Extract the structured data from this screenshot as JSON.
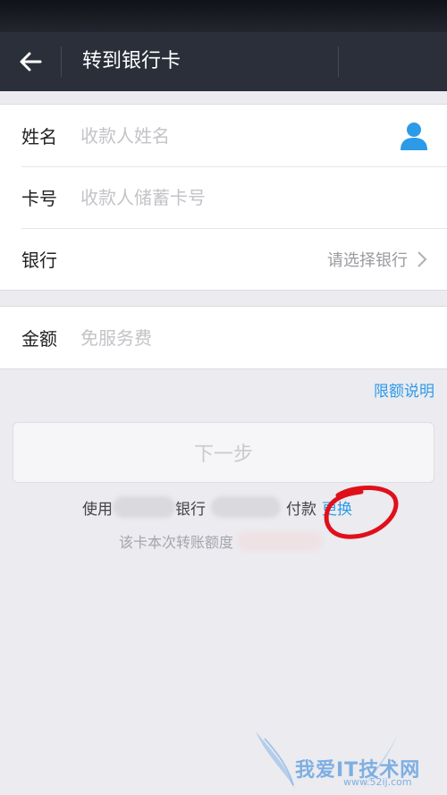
{
  "nav": {
    "title": "转到银行卡"
  },
  "form": {
    "name": {
      "label": "姓名",
      "placeholder": "收款人姓名"
    },
    "card": {
      "label": "卡号",
      "placeholder": "收款人储蓄卡号"
    },
    "bank": {
      "label": "银行",
      "select_text": "请选择银行"
    },
    "amount": {
      "label": "金额",
      "placeholder": "免服务费"
    }
  },
  "limit_link": "限额说明",
  "next_button": "下一步",
  "payment": {
    "prefix": "使用",
    "bank_word": "银行",
    "pay_word": "付款",
    "change_label": "更换",
    "quota_text": "该卡本次转账额度"
  },
  "watermark": {
    "text": "我爱IT技术网",
    "url": "www.52ij.com"
  },
  "colors": {
    "nav_bg": "#2b2f3a",
    "link": "#2d9ae8",
    "annotation": "#e0101a"
  },
  "icons": {
    "back": "arrow-left",
    "contact": "person",
    "chevron": "chevron-right"
  }
}
